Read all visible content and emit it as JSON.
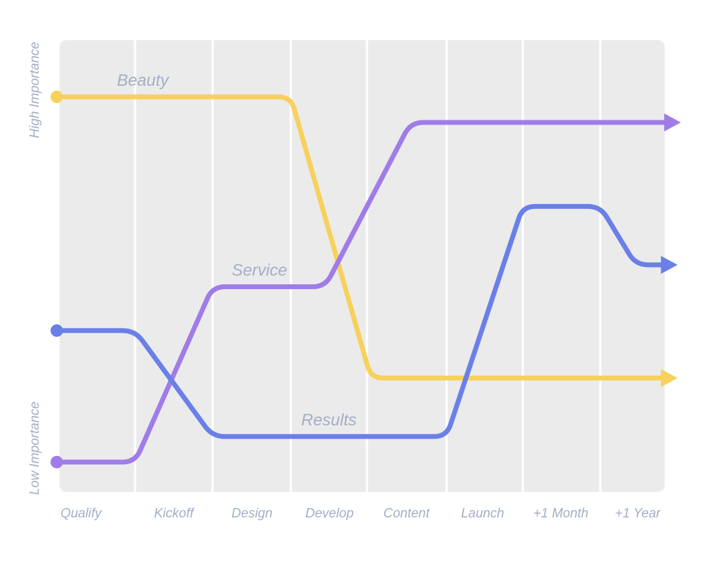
{
  "chart_data": {
    "type": "line",
    "title": "",
    "xlabel": "",
    "ylabel_high": "High Importance",
    "ylabel_low": "Low Importance",
    "categories": [
      "Qualify",
      "Kickoff",
      "Design",
      "Develop",
      "Content",
      "Launch",
      "+1 Month",
      "+1 Year"
    ],
    "ylim": [
      0,
      100
    ],
    "grid": true,
    "legend": "inline labels on lines",
    "series": [
      {
        "name": "Beauty",
        "color": "#F8D15C",
        "points": [
          [
            0,
            100
          ],
          [
            3,
            100
          ],
          [
            4.05,
            23
          ],
          [
            8.2,
            23
          ]
        ],
        "label_anchor": [
          1.45,
          100
        ]
      },
      {
        "name": "Service",
        "color": "#A07CE8",
        "points": [
          [
            0,
            0
          ],
          [
            1,
            0
          ],
          [
            2,
            48
          ],
          [
            3.45,
            48
          ],
          [
            4.55,
            93
          ],
          [
            8.25,
            93
          ]
        ],
        "label_anchor": [
          2.5,
          48
        ]
      },
      {
        "name": "Results",
        "color": "#6A7FE8",
        "points": [
          [
            0,
            36
          ],
          [
            1,
            36
          ],
          [
            2,
            7
          ],
          [
            5,
            7
          ],
          [
            6,
            70
          ],
          [
            7,
            70
          ],
          [
            7.55,
            54
          ],
          [
            8.2,
            54
          ]
        ],
        "label_anchor": [
          3.5,
          7
        ]
      }
    ]
  }
}
